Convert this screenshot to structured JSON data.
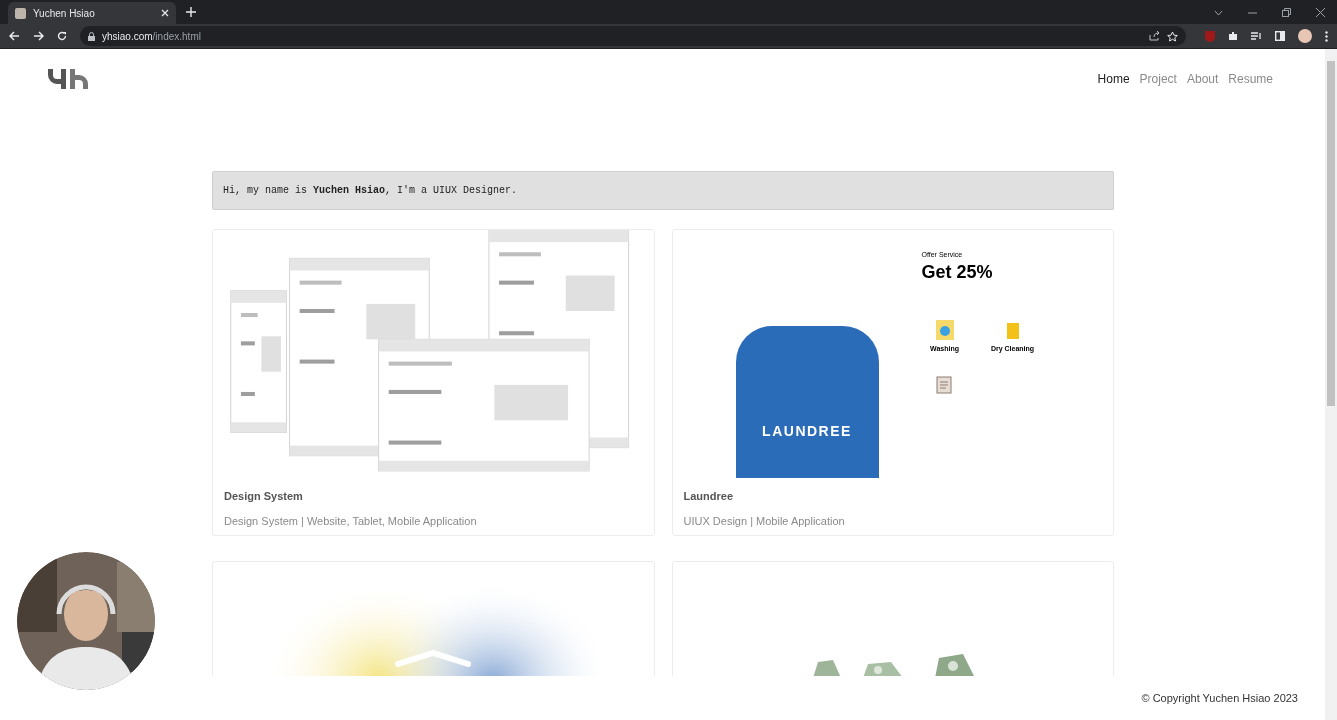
{
  "browser": {
    "tab": {
      "title": "Yuchen Hsiao"
    },
    "url": {
      "domain": "yhsiao.com",
      "path": "/index.html"
    }
  },
  "nav": [
    {
      "label": "Home",
      "selected": true
    },
    {
      "label": "Project",
      "selected": false
    },
    {
      "label": "About",
      "selected": false
    },
    {
      "label": "Resume",
      "selected": false
    }
  ],
  "intro": "Hi, my name is **Yuchen Hsiao**, I'm a UIUX Designer.",
  "projects": [
    {
      "title": "Design System",
      "subtitle": "Design System | Website, Tablet, Mobile Application",
      "thumbnail": {
        "kind": "wireframes"
      }
    },
    {
      "title": "Laundree",
      "subtitle": "UIUX Design | Mobile Application",
      "thumbnail": {
        "kind": "laundree",
        "logo": "LAUNDREE",
        "offer_label": "Offer Service",
        "offer": "Get 25%",
        "services": [
          "Washing",
          "Dry Cleaning"
        ]
      }
    },
    {
      "thumbnail": {
        "kind": "gradient"
      }
    },
    {
      "thumbnail": {
        "kind": "rocks"
      }
    }
  ],
  "footer": {
    "copyright": "© Copyright Yuchen Hsiao 2023"
  }
}
